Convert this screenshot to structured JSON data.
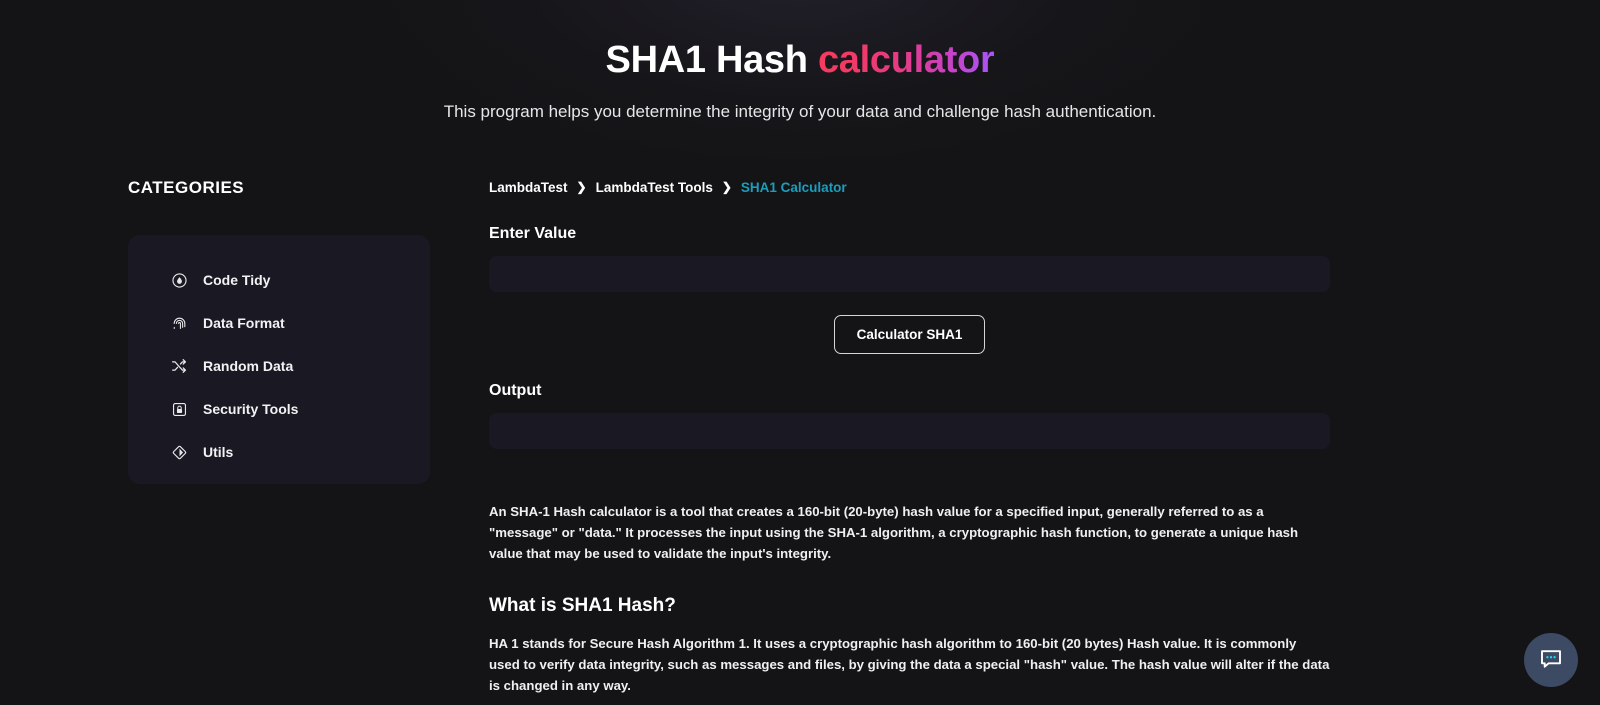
{
  "hero": {
    "title_main": "SHA1 Hash ",
    "title_accent": "calculator",
    "subtitle": "This program helps you determine the integrity of your data and challenge hash authentication.",
    "accent_gradient_from": "#f63b5f",
    "accent_gradient_to": "#a855f7"
  },
  "sidebar": {
    "heading": "CATEGORIES",
    "items": [
      {
        "label": "Code Tidy",
        "icon": "code-tidy-icon"
      },
      {
        "label": "Data Format",
        "icon": "fingerprint-icon"
      },
      {
        "label": "Random Data",
        "icon": "shuffle-icon"
      },
      {
        "label": "Security Tools",
        "icon": "lock-icon"
      },
      {
        "label": "Utils",
        "icon": "diamond-icon"
      }
    ]
  },
  "breadcrumb": {
    "items": [
      {
        "label": "LambdaTest",
        "current": false
      },
      {
        "label": "LambdaTest Tools",
        "current": false
      },
      {
        "label": "SHA1 Calculator",
        "current": true
      }
    ],
    "separator": "❯",
    "current_color": "#1c9dbb"
  },
  "form": {
    "input_label": "Enter Value",
    "input_value": "",
    "input_placeholder": "",
    "button_label": "Calculator SHA1",
    "output_label": "Output",
    "output_value": ""
  },
  "article": {
    "intro": "An SHA-1 Hash calculator is a tool that creates a 160-bit (20-byte) hash value for a specified input, generally referred to as a \"message\" or \"data.\" It processes the input using the SHA-1 algorithm, a cryptographic hash function, to generate a unique hash value that may be used to validate the input's integrity.",
    "section_heading": "What is SHA1 Hash?",
    "section_body": "HA 1 stands for Secure Hash Algorithm 1. It uses a cryptographic hash algorithm to 160-bit (20 bytes) Hash value. It is commonly used to verify data integrity, such as messages and files, by giving the data a special \"hash\" value. The hash value will alter if the data is changed in any way."
  },
  "chat": {
    "icon": "chat-bubble-icon",
    "button_color": "#3c4a63",
    "dot_color": "#22d3ee"
  }
}
